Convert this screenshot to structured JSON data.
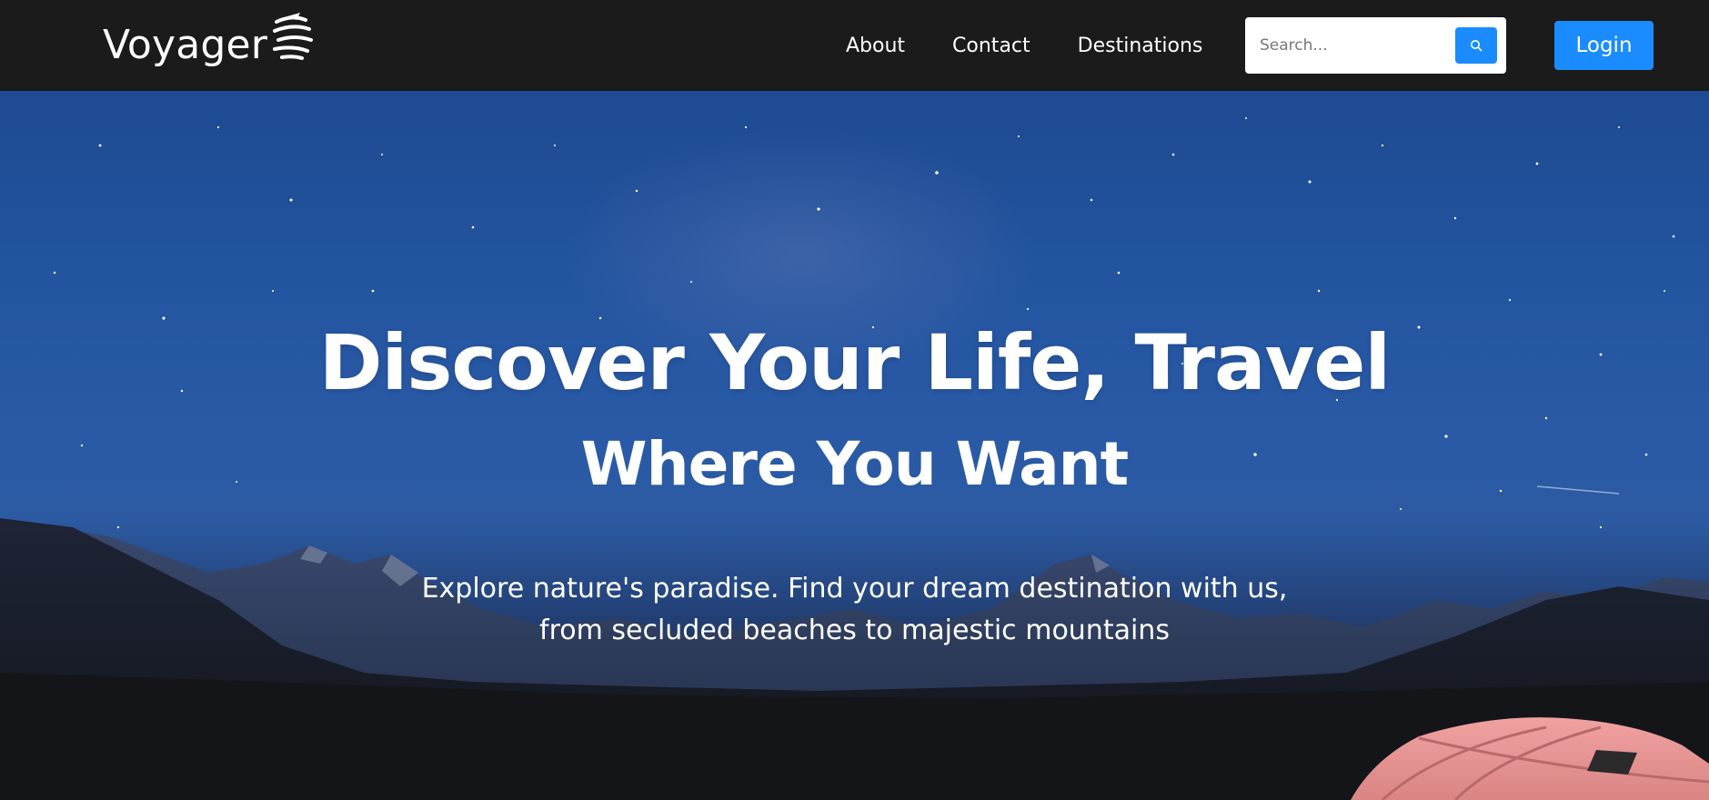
{
  "brand": {
    "name": "Voyager",
    "logo_icon": "globe-swirl-icon"
  },
  "nav": {
    "links": [
      {
        "label": "About"
      },
      {
        "label": "Contact"
      },
      {
        "label": "Destinations"
      }
    ]
  },
  "search": {
    "placeholder": "Search...",
    "value": "",
    "button_icon": "search-icon"
  },
  "login": {
    "label": "Login"
  },
  "hero": {
    "title_line1": "Discover Your Life, Travel",
    "title_line2": "Where You Want",
    "subtitle_line1": "Explore nature's paradise. Find your dream destination with us,",
    "subtitle_line2": "from secluded beaches to majestic mountains",
    "background_image": "starry-night-mountains-tent"
  },
  "colors": {
    "navbar_bg": "#1b1b1b",
    "accent": "#1a8cff",
    "hero_sky": "#2a5aa6",
    "text": "#ffffff"
  }
}
